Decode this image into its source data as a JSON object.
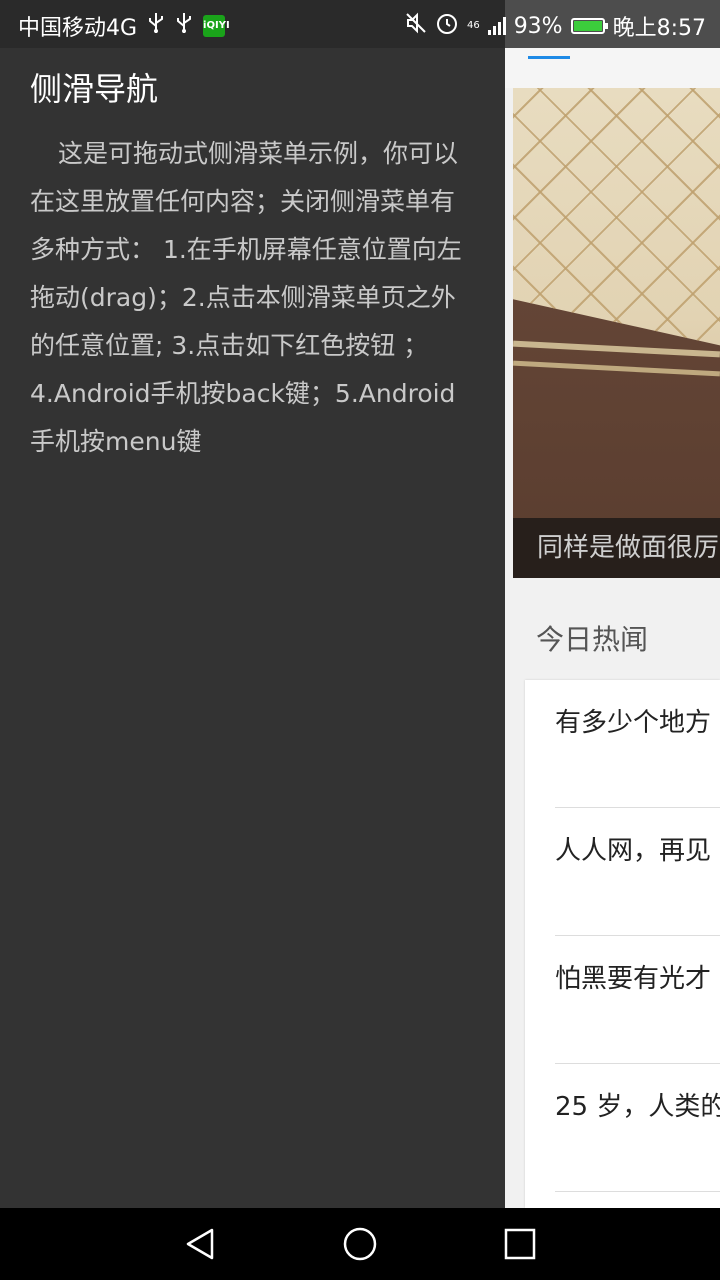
{
  "status_bar": {
    "carrier": "中国移动4G",
    "network": "46",
    "battery_percent": "93%",
    "time": "晚上8:57",
    "icons": [
      "usb-icon",
      "usb-icon",
      "iqiyi-icon",
      "mute-icon",
      "alarm-icon",
      "signal-icon",
      "battery-icon"
    ]
  },
  "drawer": {
    "title": "侧滑导航",
    "body": "这是可拖动式侧滑菜单示例，你可以在这里放置任何内容；关闭侧滑菜单有多种方式： 1.在手机屏幕任意位置向左拖动(drag)；2.点击本侧滑菜单页之外的任意位置; 3.点击如下红色按钮 ； 4.Android手机按back键；5.Android手机按menu键"
  },
  "main": {
    "hero_caption": "同样是做面很厉",
    "section_title": "今日热闻",
    "news": [
      {
        "title": "有多少个地方"
      },
      {
        "title": "人人网，再见"
      },
      {
        "title": "怕黑要有光才"
      },
      {
        "title": "25 岁，人类的"
      }
    ]
  },
  "colors": {
    "drawer_bg": "#333333",
    "accent": "#1e8ae6",
    "battery": "#3ccc3c"
  },
  "nav_bar": {
    "icons": [
      "back-icon",
      "home-icon",
      "recents-icon"
    ]
  }
}
